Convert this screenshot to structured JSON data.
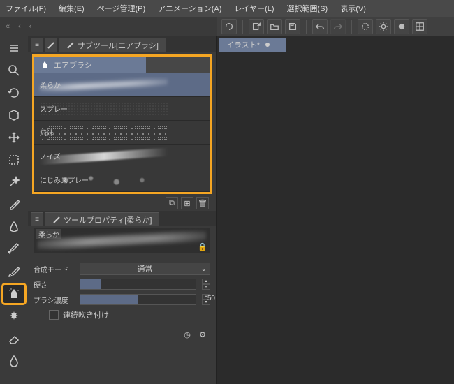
{
  "menu": {
    "file": "ファイル(F)",
    "edit": "編集(E)",
    "page": "ページ管理(P)",
    "anim": "アニメーション(A)",
    "layer": "レイヤー(L)",
    "select": "選択範囲(S)",
    "view": "表示(V)"
  },
  "nav": {
    "back": "«",
    "fwd": "‹",
    "up": "‹"
  },
  "subtool": {
    "tab_label": "サブツール[エアブラシ]",
    "group": "エアブラシ",
    "brushes": [
      {
        "label": "柔らか",
        "selected": true
      },
      {
        "label": "スプレー",
        "selected": false
      },
      {
        "label": "飛沫",
        "selected": false
      },
      {
        "label": "ノイズ",
        "selected": false
      },
      {
        "label": "にじみスプレー",
        "selected": false
      }
    ]
  },
  "toolprop": {
    "tab_label": "ツールプロパティ[柔らか]",
    "preview_name": "柔らか",
    "blend_label": "合成モード",
    "blend_value": "通常",
    "hardness_label": "硬さ",
    "hardness_pct": 18,
    "density_label": "ブラシ濃度",
    "density_value": "50",
    "density_pct": 50,
    "continuous_label": "連続吹き付け"
  },
  "doc": {
    "title": "イラスト*"
  },
  "icons": {
    "airbrush": "airbrush-icon",
    "lock": "🔒",
    "gear": "⚙",
    "clock": "◷",
    "trash": "🗑",
    "dup": "⧉",
    "new": "⊞"
  }
}
